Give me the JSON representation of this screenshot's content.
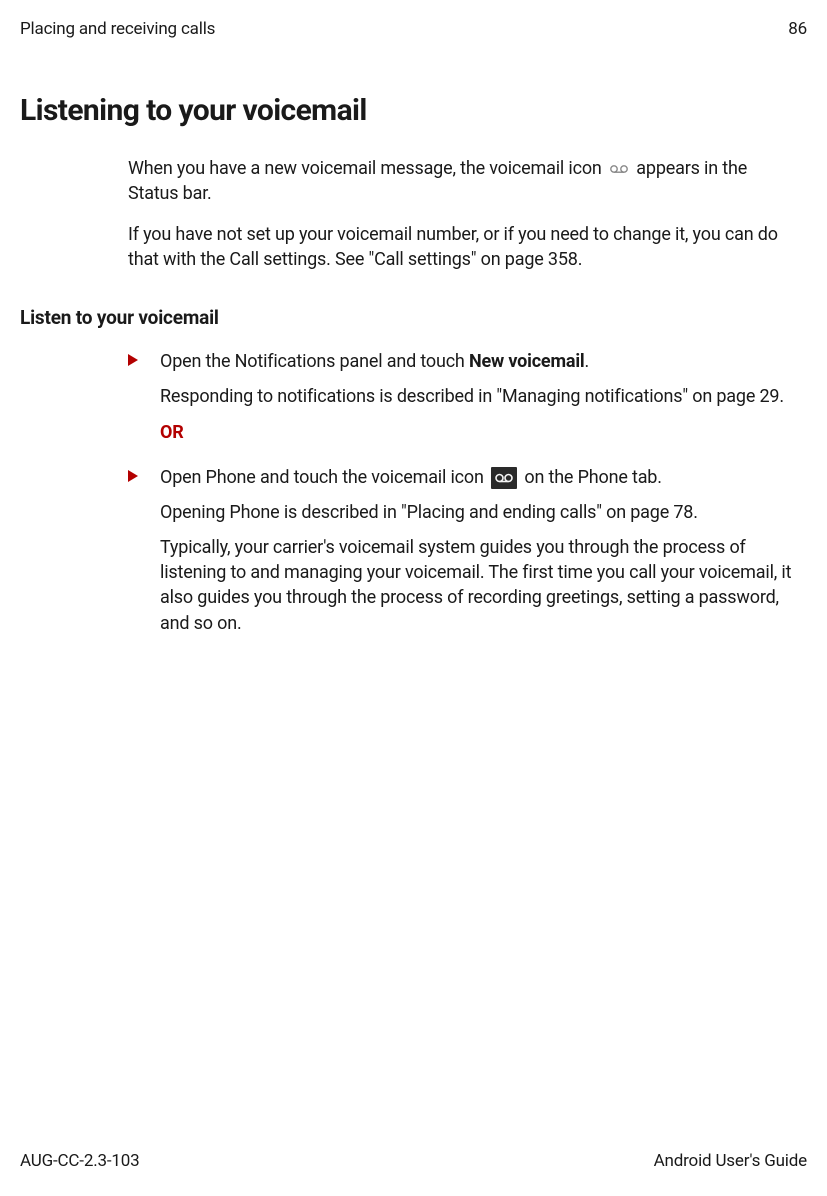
{
  "header": {
    "section": "Placing and receiving calls",
    "page_number": "86"
  },
  "title": "Listening to your voicemail",
  "intro": {
    "p1_a": "When you have a new voicemail message, the voicemail icon ",
    "p1_b": " appears in the Status bar.",
    "p2": "If you have not set up your voicemail number, or if you need to change it, you can do that with the Call settings. See \"Call settings\" on page 358."
  },
  "subheading": "Listen to your voicemail",
  "steps": {
    "item1": {
      "line1_a": "Open the Notifications panel and touch ",
      "line1_b": "New voicemail",
      "line1_c": ".",
      "line2": "Responding to notifications is described in \"Managing notifications\" on page 29.",
      "or": "OR"
    },
    "item2": {
      "line1_a": "Open Phone and touch the voicemail icon ",
      "line1_b": " on the Phone tab.",
      "line2": "Opening Phone is described in \"Placing and ending calls\" on page 78.",
      "line3": "Typically, your carrier's voicemail system guides you through the process of listening to and managing your voicemail. The first time you call your voicemail, it also guides you through the process of recording greetings, setting a password, and so on."
    }
  },
  "footer": {
    "doc_id": "AUG-CC-2.3-103",
    "doc_title": "Android User's Guide"
  }
}
